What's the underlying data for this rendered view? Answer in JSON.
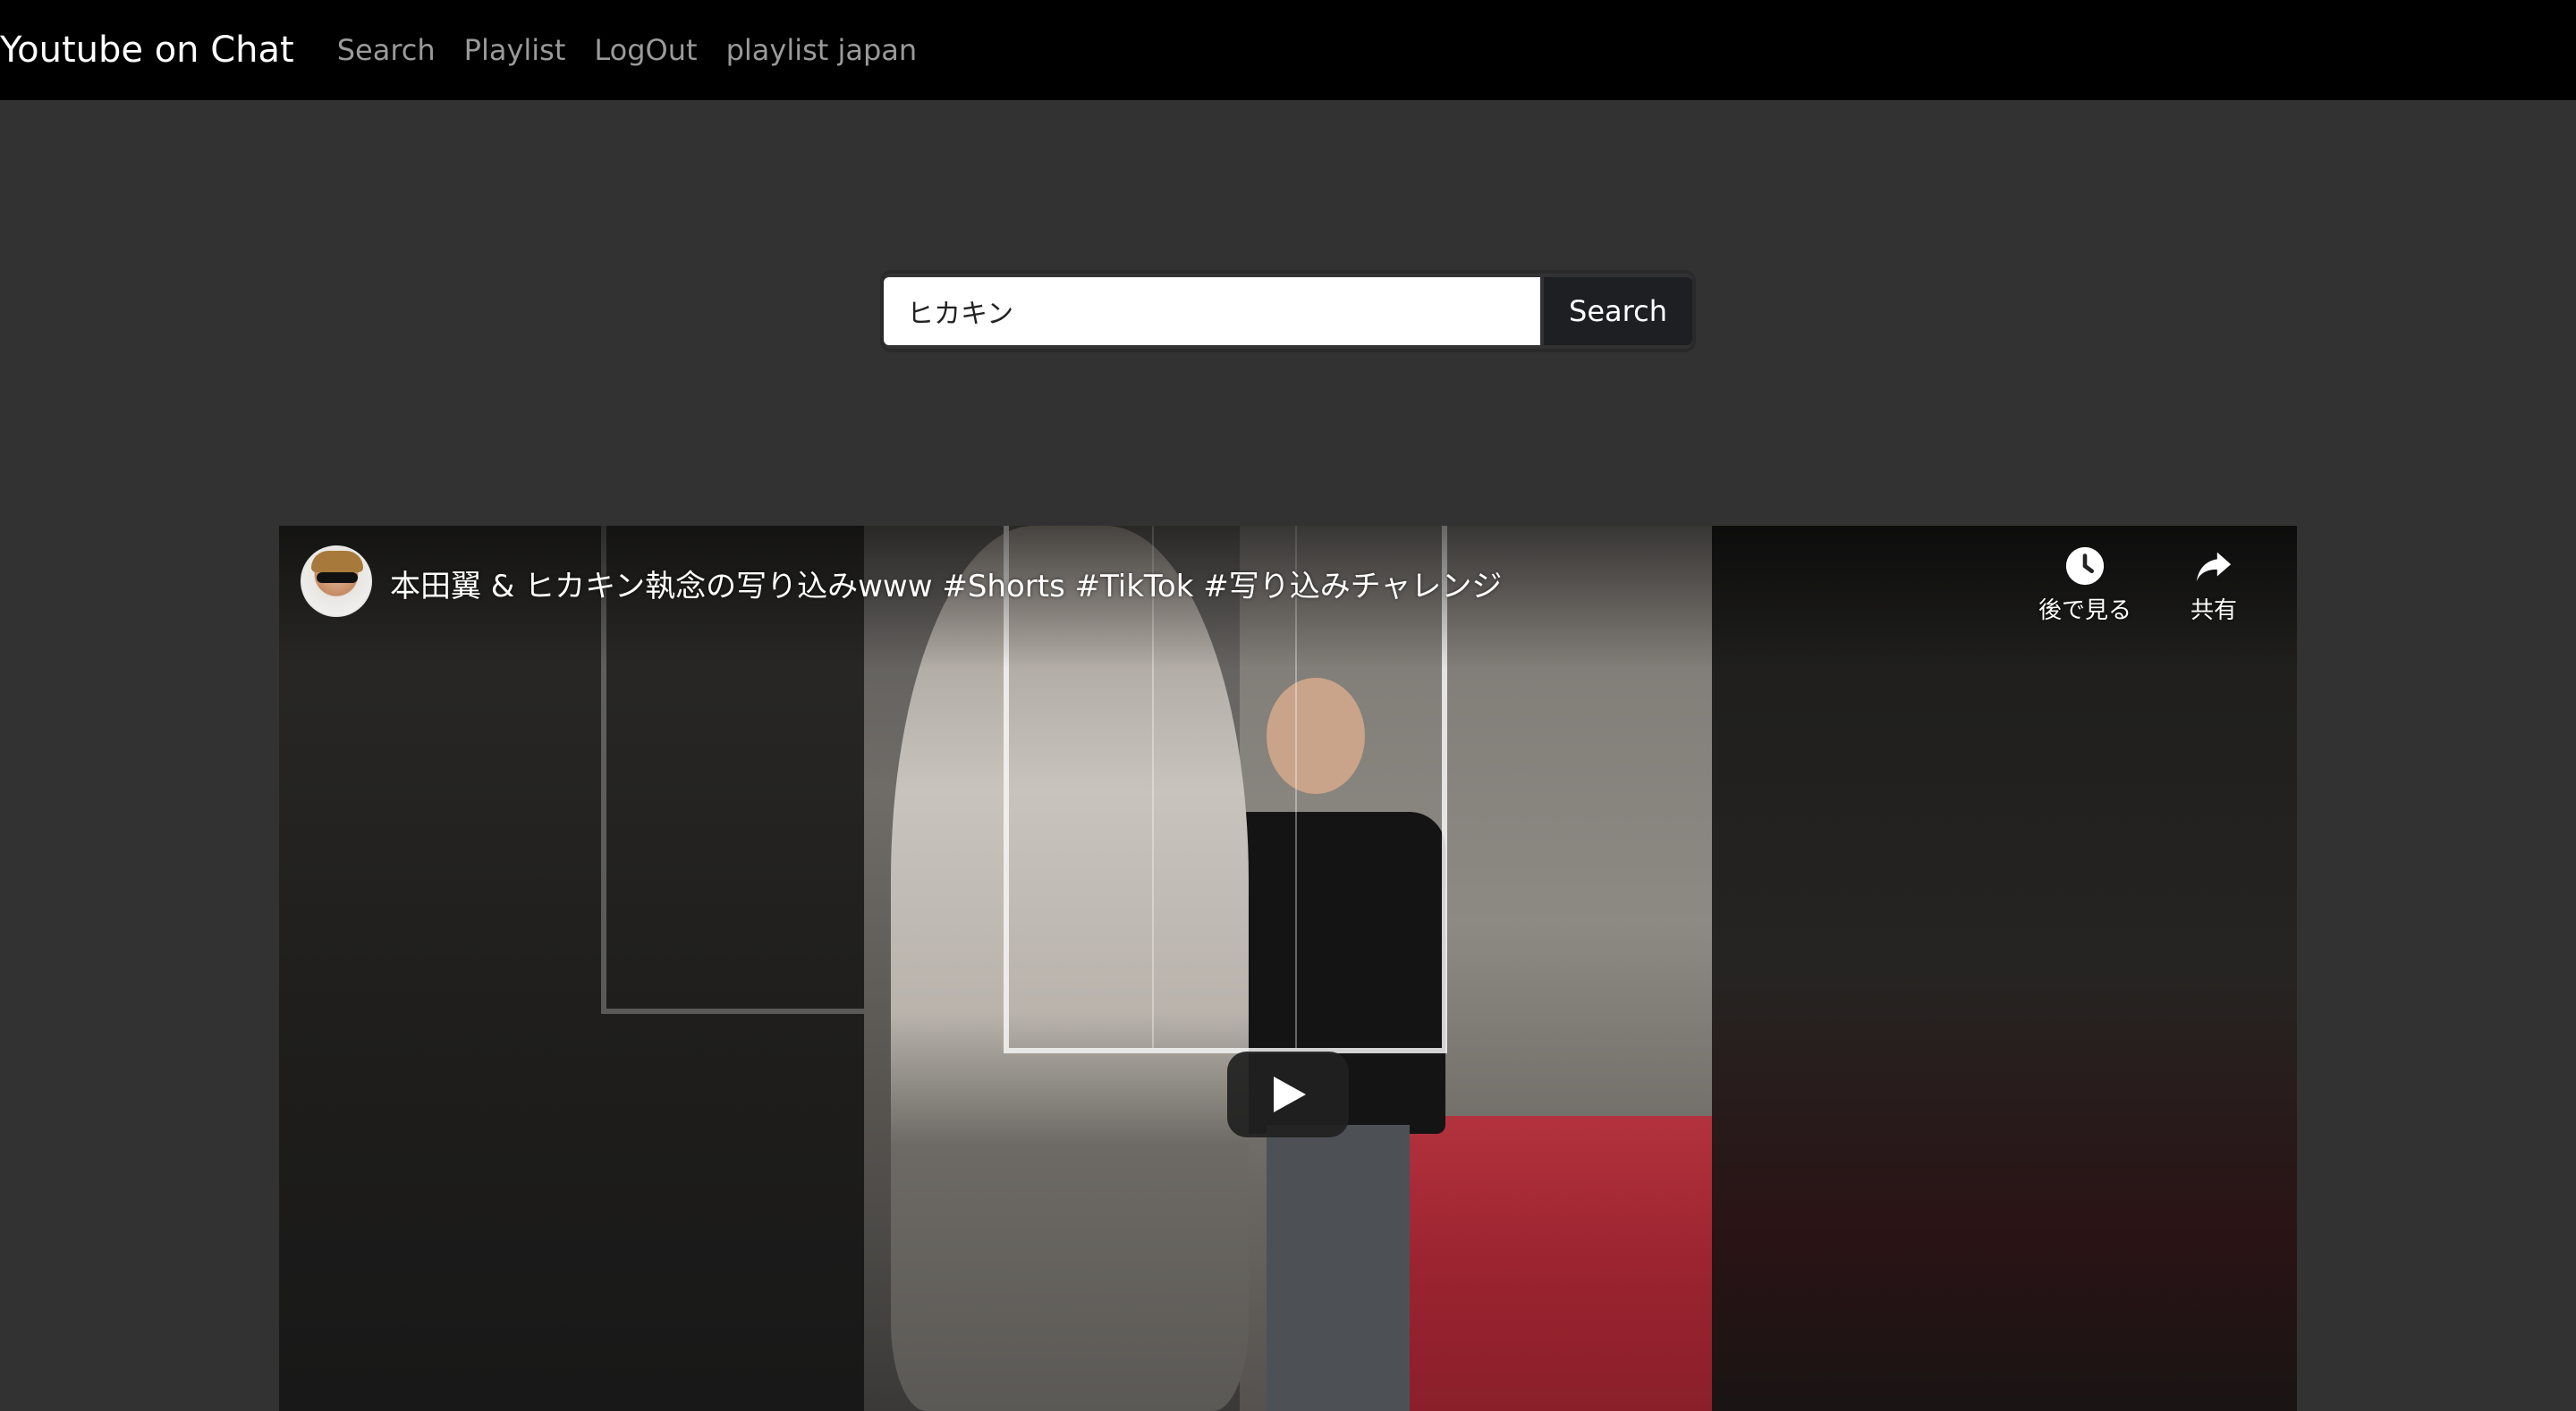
{
  "navbar": {
    "brand": "Youtube on Chat",
    "links": [
      "Search",
      "Playlist",
      "LogOut",
      "playlist japan"
    ]
  },
  "search": {
    "value": "ヒカキン",
    "placeholder": "",
    "button_label": "Search"
  },
  "video": {
    "title": "本田翼 & ヒカキン執念の写り込みwww #Shorts #TikTok #写り込みチャレンジ",
    "watch_later_label": "後で見る",
    "share_label": "共有",
    "icons": [
      "avatar",
      "clock-icon",
      "share-icon",
      "play-icon"
    ]
  },
  "colors": {
    "navbar_bg": "#000000",
    "page_bg": "#323232",
    "nav_link": "#9a9a9a",
    "button_bg": "#1e1f22"
  }
}
